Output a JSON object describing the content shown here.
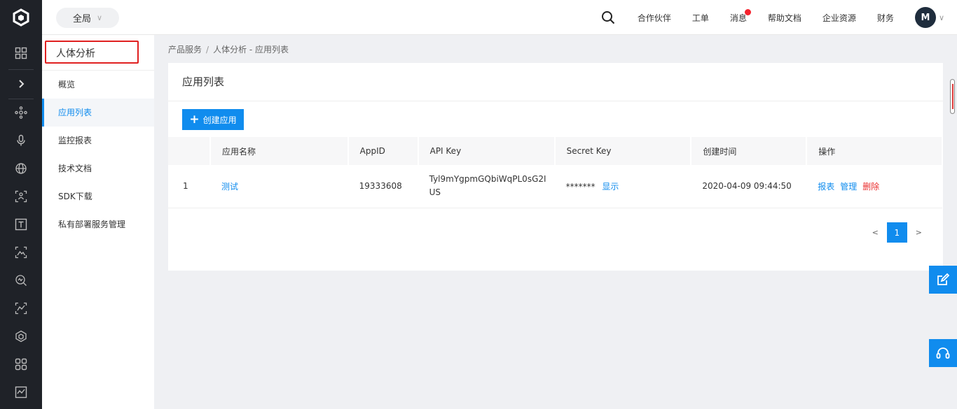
{
  "topbar": {
    "scope_label": "全局",
    "nav": [
      "合作伙伴",
      "工单",
      "消息",
      "帮助文档",
      "企业资源",
      "财务"
    ],
    "avatar_initial": "M"
  },
  "sidebar": {
    "title": "人体分析",
    "items": [
      {
        "label": "概览"
      },
      {
        "label": "应用列表"
      },
      {
        "label": "监控报表"
      },
      {
        "label": "技术文档"
      },
      {
        "label": "SDK下载"
      },
      {
        "label": "私有部署服务管理"
      }
    ],
    "active_index": 1
  },
  "breadcrumb": {
    "root": "产品服务",
    "separator": "/",
    "current": "人体分析 - 应用列表"
  },
  "card": {
    "title": "应用列表",
    "create_label": "创建应用"
  },
  "table": {
    "columns": [
      "",
      "应用名称",
      "AppID",
      "API Key",
      "Secret Key",
      "创建时间",
      "操作"
    ],
    "rows": [
      {
        "index": "1",
        "name": "测试",
        "app_id": "19333608",
        "api_key_line1": "Tyl9mYgpmGQbiWqPL0sG2I",
        "api_key_line2": "US",
        "secret_mask": "*******",
        "secret_show": "显示",
        "created": "2020-04-09 09:44:50",
        "op_report": "报表",
        "op_manage": "管理",
        "op_delete": "删除"
      }
    ]
  },
  "pagination": {
    "prev": "<",
    "page": "1",
    "next": ">"
  },
  "colors": {
    "accent": "#108cee",
    "rail_bg": "#1f2228",
    "danger": "#ea2e2e",
    "highlight_border": "#e02020",
    "badge_dot": "#f5222d"
  }
}
